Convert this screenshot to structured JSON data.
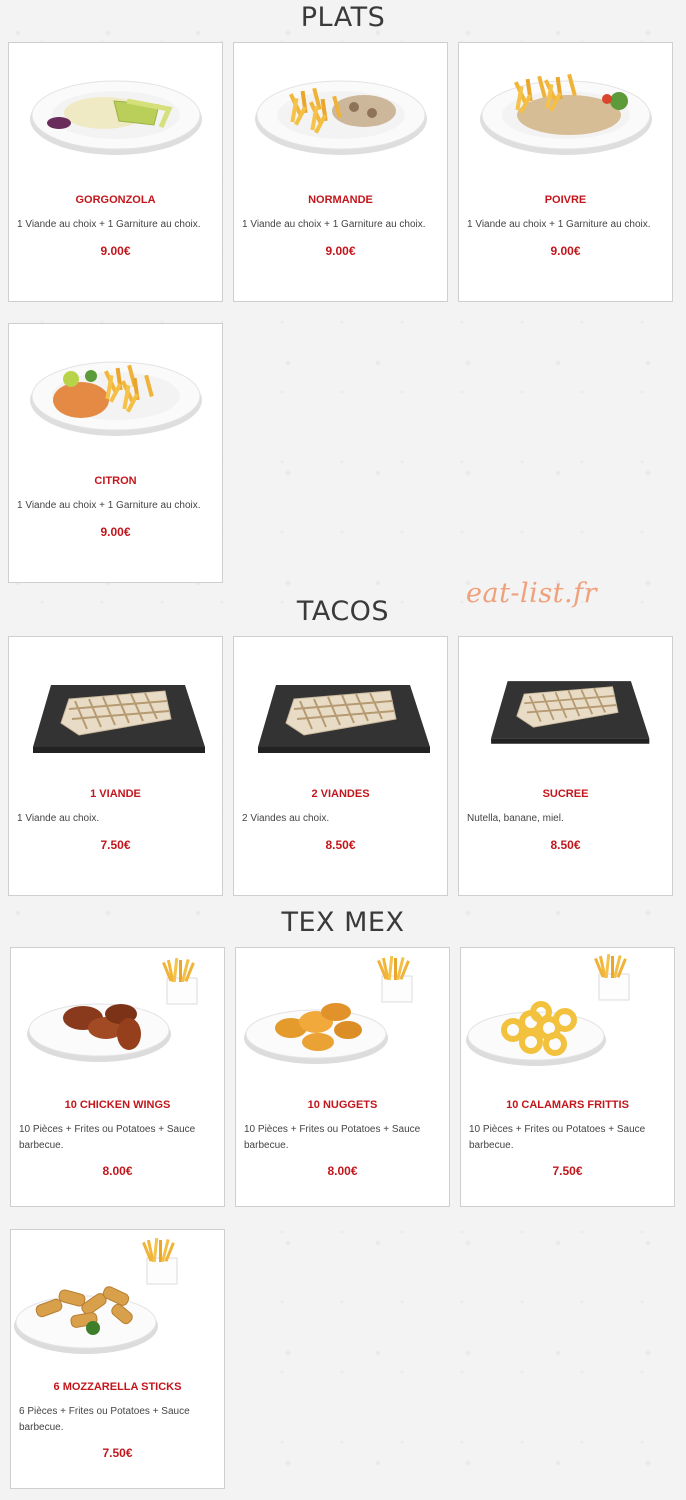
{
  "watermark": "eat-list.fr",
  "sections": {
    "plats": {
      "title": "PLATS",
      "items": [
        {
          "name": "GORGONZOLA",
          "desc": "1 Viande au choix + 1 Garniture au choix.",
          "price": "9.00€"
        },
        {
          "name": "NORMANDE",
          "desc": "1 Viande au choix + 1 Garniture au choix.",
          "price": "9.00€"
        },
        {
          "name": "POIVRE",
          "desc": "1 Viande au choix + 1 Garniture au choix.",
          "price": "9.00€"
        },
        {
          "name": "CITRON",
          "desc": "1 Viande au choix + 1 Garniture au choix.",
          "price": "9.00€"
        }
      ]
    },
    "tacos": {
      "title": "TACOS",
      "items": [
        {
          "name": "1 VIANDE",
          "desc": "1 Viande au choix.",
          "price": "7.50€"
        },
        {
          "name": "2 VIANDES",
          "desc": "2 Viandes au choix.",
          "price": "8.50€"
        },
        {
          "name": "SUCREE",
          "desc": "Nutella, banane, miel.",
          "price": "8.50€"
        }
      ]
    },
    "texmex": {
      "title": "TEX MEX",
      "items": [
        {
          "name": "10 CHICKEN WINGS",
          "desc": "10 Pièces + Frites ou Potatoes + Sauce barbecue.",
          "price": "8.00€"
        },
        {
          "name": "10 NUGGETS",
          "desc": "10 Pièces + Frites ou Potatoes + Sauce barbecue.",
          "price": "8.00€"
        },
        {
          "name": "10 CALAMARS FRITTIS",
          "desc": "10 Pièces + Frites ou Potatoes + Sauce barbecue.",
          "price": "7.50€"
        },
        {
          "name": "6 MOZZARELLA STICKS",
          "desc": "6 Pièces + Frites ou Potatoes + Sauce barbecue.",
          "price": "7.50€"
        }
      ]
    }
  },
  "colors": {
    "accent": "#c3161c",
    "watermark": "#f0a07a"
  }
}
